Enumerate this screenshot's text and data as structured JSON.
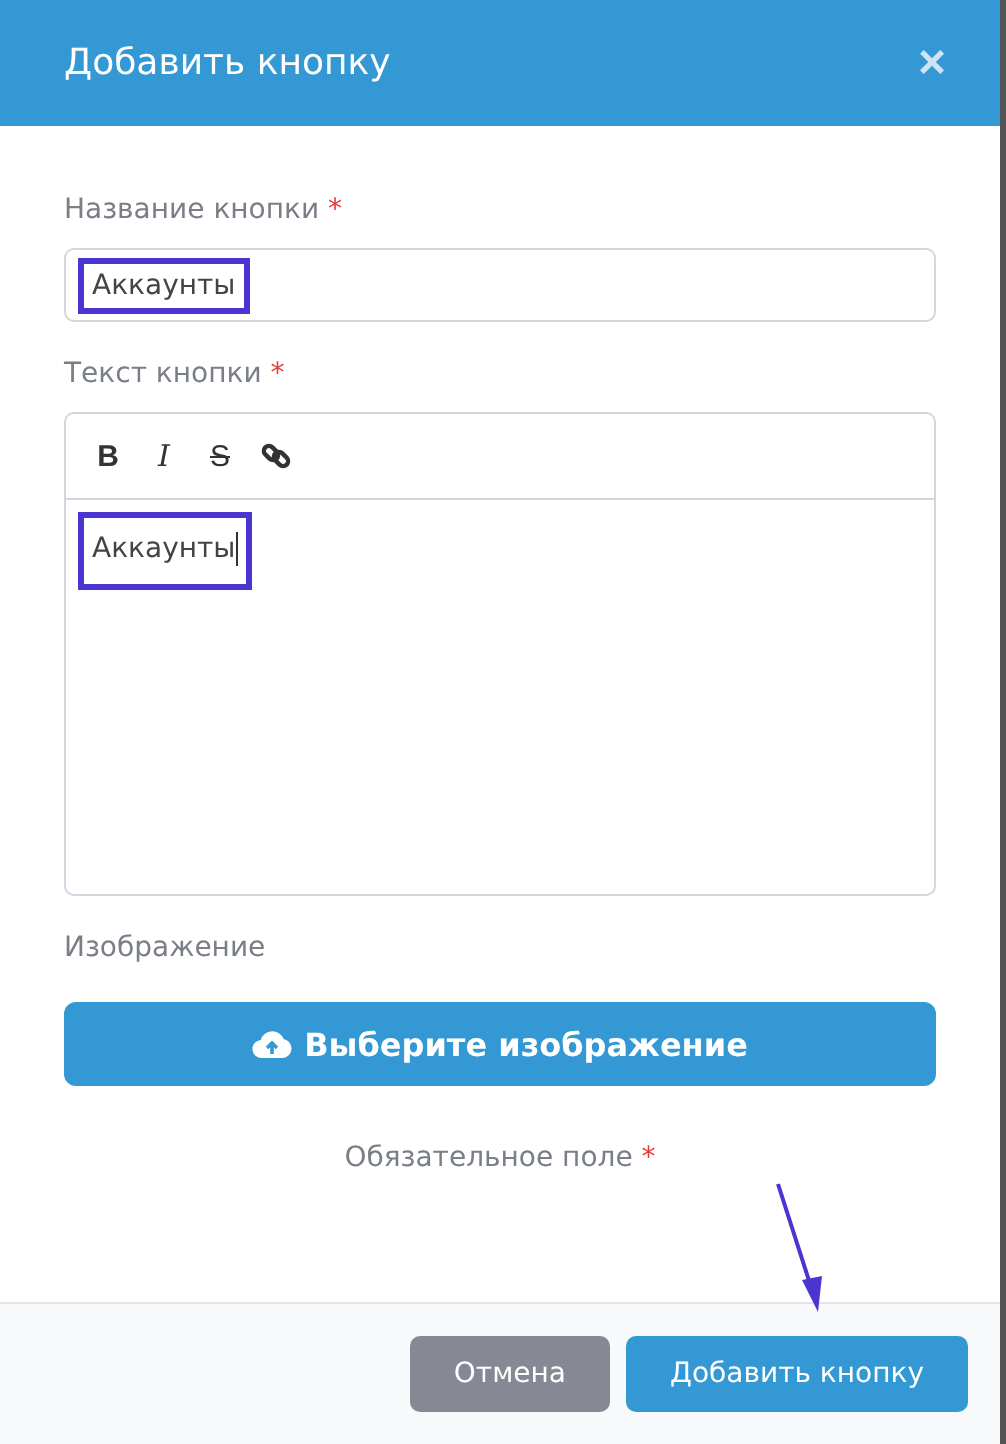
{
  "dialog": {
    "title": "Добавить кнопку",
    "close": "×"
  },
  "name_field": {
    "label": "Название кнопки",
    "required_mark": "*",
    "value": "Аккаунты",
    "highlighted": true
  },
  "text_field": {
    "label": "Текст кнопки",
    "required_mark": "*",
    "toolbar": [
      {
        "kind": "bold",
        "label": "B"
      },
      {
        "kind": "italic",
        "label": "I"
      },
      {
        "kind": "strike",
        "label": "S"
      },
      {
        "kind": "link"
      }
    ],
    "value": "Аккаунты",
    "highlighted": true
  },
  "image": {
    "label": "Изображение",
    "button": "Выберите изображение"
  },
  "required_note": {
    "text": "Обязательное поле",
    "mark": "*"
  },
  "buttons": [
    {
      "kind": "secondary",
      "label": "Отмена"
    },
    {
      "kind": "primary",
      "label": "Добавить кнопку"
    }
  ]
}
